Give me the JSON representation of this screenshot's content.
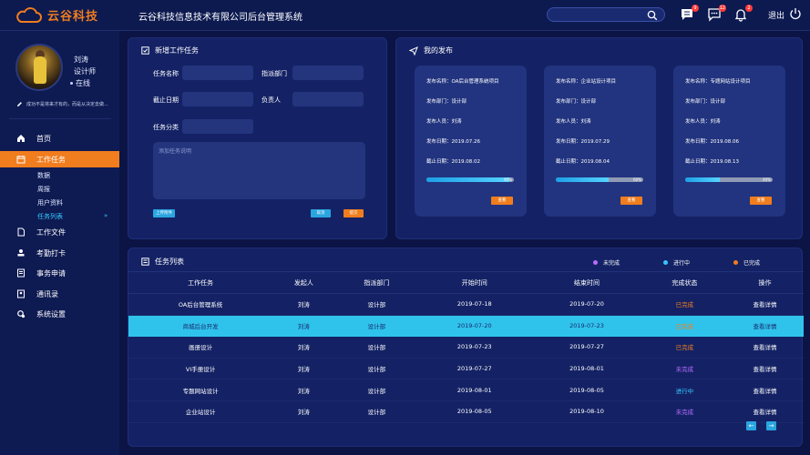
{
  "header": {
    "logo_text": "云谷科技",
    "system_title": "云谷科技信息技术有限公司后台管理系统",
    "search_placeholder": "",
    "badges": {
      "messages": "9",
      "chat": "12",
      "notifications": "2"
    },
    "logout_label": "退出"
  },
  "user": {
    "name": "刘涛",
    "role": "设计师",
    "status": "在线",
    "motto": "成功不是将来才有的，而是从决定去做..."
  },
  "sidebar": {
    "items": [
      {
        "label": "首页",
        "icon": "home-icon"
      },
      {
        "label": "工作任务",
        "icon": "calendar-icon"
      },
      {
        "label": "工作文件",
        "icon": "file-icon"
      },
      {
        "label": "考勤打卡",
        "icon": "stamp-icon"
      },
      {
        "label": "事务申请",
        "icon": "document-icon"
      },
      {
        "label": "通讯录",
        "icon": "contacts-icon"
      },
      {
        "label": "系统设置",
        "icon": "settings-icon"
      }
    ],
    "sub_items": [
      "数据",
      "周报",
      "用户资料",
      "任务列表"
    ],
    "sub_arrow": "»"
  },
  "new_task": {
    "title": "新增工作任务",
    "labels": {
      "name": "任务名称",
      "dept": "指派部门",
      "deadline": "截止日期",
      "owner": "负责人",
      "category": "任务分类"
    },
    "desc_placeholder": "添加任务说明",
    "upload_label": "上传附件",
    "cancel_label": "取消",
    "submit_label": "提交"
  },
  "my_posts": {
    "title": "我的发布",
    "cards": [
      {
        "name": "发布名称：OA后台管理系统项目",
        "dept": "发布部门：设计部",
        "person": "发布人员：刘涛",
        "date": "发布日期：2019.07.26",
        "deadline": "截止日期：2019.08.02",
        "progress": 95,
        "progress_label": "95%",
        "btn": "查看"
      },
      {
        "name": "发布名称：企业站设计项目",
        "dept": "发布部门：设计部",
        "person": "发布人员：刘涛",
        "date": "发布日期：2019.07.29",
        "deadline": "截止日期：2019.08.04",
        "progress": 60,
        "progress_label": "60%",
        "btn": "查看"
      },
      {
        "name": "发布名称：专题网站设计项目",
        "dept": "发布部门：设计部",
        "person": "发布人员：刘涛",
        "date": "发布日期：2019.08.06",
        "deadline": "截止日期：2019.08.13",
        "progress": 40,
        "progress_label": "40%",
        "btn": "查看"
      }
    ]
  },
  "task_list": {
    "title": "任务列表",
    "legend": [
      {
        "label": "未完成",
        "color": "#b86cff"
      },
      {
        "label": "进行中",
        "color": "#36c6ff"
      },
      {
        "label": "已完成",
        "color": "#f07d1e"
      }
    ],
    "columns": [
      "工作任务",
      "发起人",
      "指派部门",
      "开始时间",
      "结束时间",
      "完成状态",
      "操作"
    ],
    "rows": [
      {
        "task": "OA后台管理系统",
        "owner": "刘涛",
        "dept": "设计部",
        "start": "2019-07-18",
        "end": "2019-07-20",
        "status": "已完成",
        "status_color": "#f07d1e",
        "action": "查看详情"
      },
      {
        "task": "商城后台开发",
        "owner": "刘涛",
        "dept": "设计部",
        "start": "2019-07-20",
        "end": "2019-07-23",
        "status": "已完成",
        "status_color": "#f07d1e",
        "action": "查看详情"
      },
      {
        "task": "画册设计",
        "owner": "刘涛",
        "dept": "设计部",
        "start": "2019-07-23",
        "end": "2019-07-27",
        "status": "已完成",
        "status_color": "#f07d1e",
        "action": "查看详情"
      },
      {
        "task": "VI手册设计",
        "owner": "刘涛",
        "dept": "设计部",
        "start": "2019-07-27",
        "end": "2019-08-01",
        "status": "未完成",
        "status_color": "#b86cff",
        "action": "查看详情"
      },
      {
        "task": "专题网站设计",
        "owner": "刘涛",
        "dept": "设计部",
        "start": "2019-08-01",
        "end": "2019-08-05",
        "status": "进行中",
        "status_color": "#36c6ff",
        "action": "查看详情"
      },
      {
        "task": "企业站设计",
        "owner": "刘涛",
        "dept": "设计部",
        "start": "2019-08-05",
        "end": "2019-08-10",
        "status": "未完成",
        "status_color": "#b86cff",
        "action": "查看详情"
      }
    ],
    "highlight_row": 1,
    "prev_label": "←",
    "next_label": "→"
  }
}
